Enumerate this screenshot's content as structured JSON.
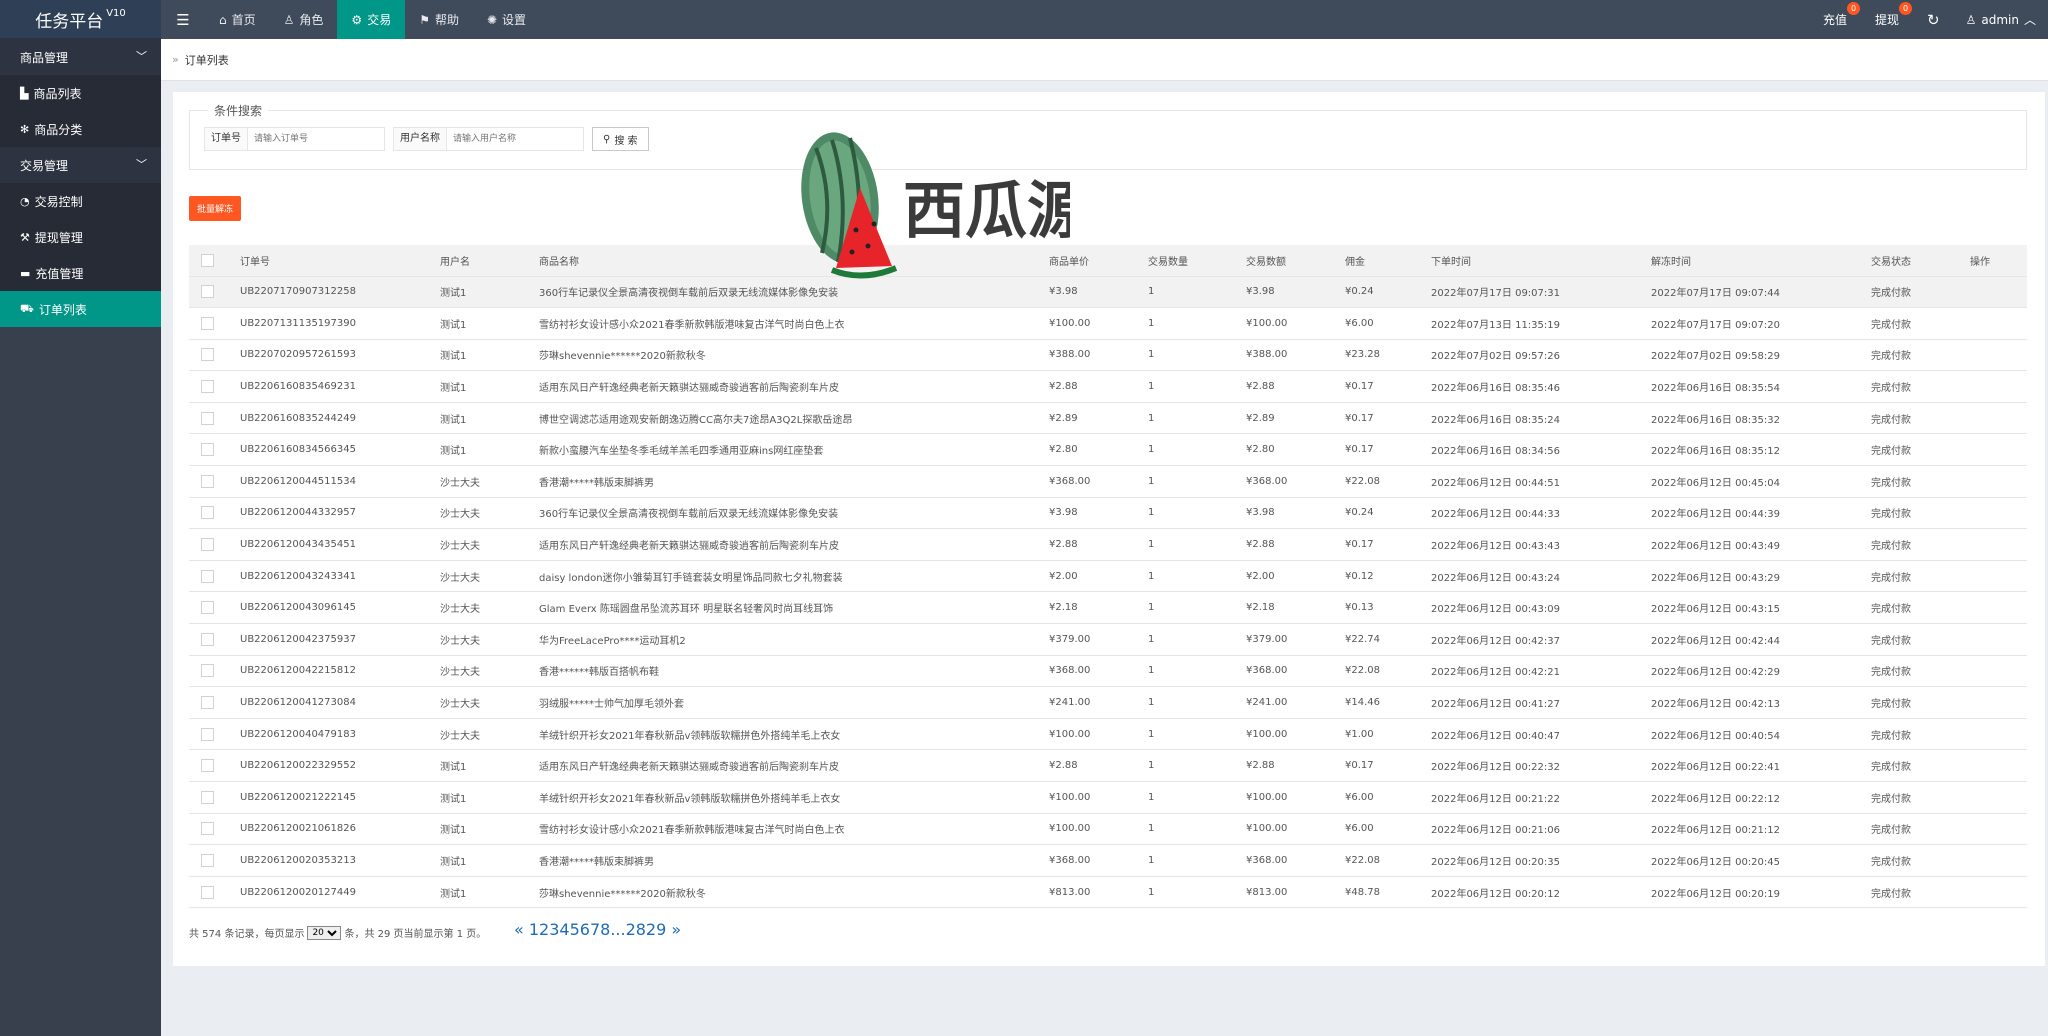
{
  "app": {
    "title": "任务平台",
    "version": "V10"
  },
  "topnav": [
    {
      "label": "首页",
      "icon": "home-icon",
      "glyph": "⌂",
      "active": false
    },
    {
      "label": "角色",
      "icon": "user-icon",
      "glyph": "♙",
      "active": false
    },
    {
      "label": "交易",
      "icon": "exchange-icon",
      "glyph": "⚙",
      "active": true
    },
    {
      "label": "帮助",
      "icon": "flag-icon",
      "glyph": "⚑",
      "active": false
    },
    {
      "label": "设置",
      "icon": "gear-icon",
      "glyph": "✺",
      "active": false
    }
  ],
  "topright": {
    "recharge_label": "充值",
    "recharge_badge": "0",
    "withdraw_label": "提现",
    "withdraw_badge": "0",
    "user": "admin"
  },
  "sidebar": {
    "groups": [
      {
        "label": "商品管理",
        "items": [
          {
            "label": "商品列表",
            "icon": "cart-icon",
            "glyph": "▙",
            "active": false
          },
          {
            "label": "商品分类",
            "icon": "snowflake-icon",
            "glyph": "✻",
            "active": false
          }
        ]
      },
      {
        "label": "交易管理",
        "items": [
          {
            "label": "交易控制",
            "icon": "dashboard-icon",
            "glyph": "◔",
            "active": false
          },
          {
            "label": "提现管理",
            "icon": "gavel-icon",
            "glyph": "⚒",
            "active": false
          },
          {
            "label": "充值管理",
            "icon": "comment-icon",
            "glyph": "▬",
            "active": false
          },
          {
            "label": "订单列表",
            "icon": "cart-icon",
            "glyph": "⛟",
            "active": true
          }
        ]
      }
    ]
  },
  "breadcrumb": {
    "label": "订单列表"
  },
  "search": {
    "legend": "条件搜索",
    "order_label": "订单号",
    "order_placeholder": "请输入订单号",
    "username_label": "用户名称",
    "username_placeholder": "请输入用户名称",
    "button": "搜 索"
  },
  "batch_button": "批量解冻",
  "table": {
    "headers": [
      "订单号",
      "用户名",
      "商品名称",
      "商品单价",
      "交易数量",
      "交易数额",
      "佣金",
      "下单时间",
      "解冻时间",
      "交易状态",
      "操作"
    ],
    "rows": [
      [
        "UB2207170907312258",
        "测试1",
        "360行车记录仪全景高清夜视倒车载前后双录无线流媒体影像免安装",
        "¥3.98",
        "1",
        "¥3.98",
        "¥0.24",
        "2022年07月17日 09:07:31",
        "2022年07月17日 09:07:44",
        "完成付款",
        ""
      ],
      [
        "UB2207131135197390",
        "测试1",
        "雪纺衬衫女设计感小众2021春季新款韩版港味复古洋气时尚白色上衣",
        "¥100.00",
        "1",
        "¥100.00",
        "¥6.00",
        "2022年07月13日 11:35:19",
        "2022年07月17日 09:07:20",
        "完成付款",
        ""
      ],
      [
        "UB2207020957261593",
        "测试1",
        "莎琳shevennie******2020新款秋冬",
        "¥388.00",
        "1",
        "¥388.00",
        "¥23.28",
        "2022年07月02日 09:57:26",
        "2022年07月02日 09:58:29",
        "完成付款",
        ""
      ],
      [
        "UB2206160835469231",
        "测试1",
        "适用东风日产轩逸经典老新天籁骐达骊威奇骏逍客前后陶瓷刹车片皮",
        "¥2.88",
        "1",
        "¥2.88",
        "¥0.17",
        "2022年06月16日 08:35:46",
        "2022年06月16日 08:35:54",
        "完成付款",
        ""
      ],
      [
        "UB2206160835244249",
        "测试1",
        "博世空调滤芯适用途观安新朗逸迈腾CC高尔夫7途昂A3Q2L探歌岳途昂",
        "¥2.89",
        "1",
        "¥2.89",
        "¥0.17",
        "2022年06月16日 08:35:24",
        "2022年06月16日 08:35:32",
        "完成付款",
        ""
      ],
      [
        "UB2206160834566345",
        "测试1",
        "新款小蛮腰汽车坐垫冬季毛绒羊羔毛四季通用亚麻ins网红座垫套",
        "¥2.80",
        "1",
        "¥2.80",
        "¥0.17",
        "2022年06月16日 08:34:56",
        "2022年06月16日 08:35:12",
        "完成付款",
        ""
      ],
      [
        "UB2206120044511534",
        "沙士大夫",
        "香港潮*****韩版束脚裤男",
        "¥368.00",
        "1",
        "¥368.00",
        "¥22.08",
        "2022年06月12日 00:44:51",
        "2022年06月12日 00:45:04",
        "完成付款",
        ""
      ],
      [
        "UB2206120044332957",
        "沙士大夫",
        "360行车记录仪全景高清夜视倒车载前后双录无线流媒体影像免安装",
        "¥3.98",
        "1",
        "¥3.98",
        "¥0.24",
        "2022年06月12日 00:44:33",
        "2022年06月12日 00:44:39",
        "完成付款",
        ""
      ],
      [
        "UB2206120043435451",
        "沙士大夫",
        "适用东风日产轩逸经典老新天籁骐达骊威奇骏逍客前后陶瓷刹车片皮",
        "¥2.88",
        "1",
        "¥2.88",
        "¥0.17",
        "2022年06月12日 00:43:43",
        "2022年06月12日 00:43:49",
        "完成付款",
        ""
      ],
      [
        "UB2206120043243341",
        "沙士大夫",
        "daisy london迷你小雏菊耳钉手链套装女明星饰品同款七夕礼物套装",
        "¥2.00",
        "1",
        "¥2.00",
        "¥0.12",
        "2022年06月12日 00:43:24",
        "2022年06月12日 00:43:29",
        "完成付款",
        ""
      ],
      [
        "UB2206120043096145",
        "沙士大夫",
        "Glam Everx 陈瑶圆盘吊坠流苏耳环 明星联名轻奢风时尚耳线耳饰",
        "¥2.18",
        "1",
        "¥2.18",
        "¥0.13",
        "2022年06月12日 00:43:09",
        "2022年06月12日 00:43:15",
        "完成付款",
        ""
      ],
      [
        "UB2206120042375937",
        "沙士大夫",
        "华为FreeLacePro****运动耳机2",
        "¥379.00",
        "1",
        "¥379.00",
        "¥22.74",
        "2022年06月12日 00:42:37",
        "2022年06月12日 00:42:44",
        "完成付款",
        ""
      ],
      [
        "UB2206120042215812",
        "沙士大夫",
        "香港******韩版百搭帆布鞋",
        "¥368.00",
        "1",
        "¥368.00",
        "¥22.08",
        "2022年06月12日 00:42:21",
        "2022年06月12日 00:42:29",
        "完成付款",
        ""
      ],
      [
        "UB2206120041273084",
        "沙士大夫",
        "羽绒服*****士帅气加厚毛领外套",
        "¥241.00",
        "1",
        "¥241.00",
        "¥14.46",
        "2022年06月12日 00:41:27",
        "2022年06月12日 00:42:13",
        "完成付款",
        ""
      ],
      [
        "UB2206120040479183",
        "沙士大夫",
        "羊绒针织开衫女2021年春秋新品v领韩版软糯拼色外搭纯羊毛上衣女",
        "¥100.00",
        "1",
        "¥100.00",
        "¥1.00",
        "2022年06月12日 00:40:47",
        "2022年06月12日 00:40:54",
        "完成付款",
        ""
      ],
      [
        "UB2206120022329552",
        "测试1",
        "适用东风日产轩逸经典老新天籁骐达骊威奇骏逍客前后陶瓷刹车片皮",
        "¥2.88",
        "1",
        "¥2.88",
        "¥0.17",
        "2022年06月12日 00:22:32",
        "2022年06月12日 00:22:41",
        "完成付款",
        ""
      ],
      [
        "UB2206120021222145",
        "测试1",
        "羊绒针织开衫女2021年春秋新品v领韩版软糯拼色外搭纯羊毛上衣女",
        "¥100.00",
        "1",
        "¥100.00",
        "¥6.00",
        "2022年06月12日 00:21:22",
        "2022年06月12日 00:22:12",
        "完成付款",
        ""
      ],
      [
        "UB2206120021061826",
        "测试1",
        "雪纺衬衫女设计感小众2021春季新款韩版港味复古洋气时尚白色上衣",
        "¥100.00",
        "1",
        "¥100.00",
        "¥6.00",
        "2022年06月12日 00:21:06",
        "2022年06月12日 00:21:12",
        "完成付款",
        ""
      ],
      [
        "UB2206120020353213",
        "测试1",
        "香港潮*****韩版束脚裤男",
        "¥368.00",
        "1",
        "¥368.00",
        "¥22.08",
        "2022年06月12日 00:20:35",
        "2022年06月12日 00:20:45",
        "完成付款",
        ""
      ],
      [
        "UB2206120020127449",
        "测试1",
        "莎琳shevennie******2020新款秋冬",
        "¥813.00",
        "1",
        "¥813.00",
        "¥48.78",
        "2022年06月12日 00:20:12",
        "2022年06月12日 00:20:19",
        "完成付款",
        ""
      ]
    ]
  },
  "pagination": {
    "info_prefix": "共 574 条记录，每页显示",
    "page_size": "20",
    "info_suffix": "条，共 29 页当前显示第 1 页。",
    "links": "« 12345678...2829 »"
  },
  "watermark": {
    "text": "西瓜源码"
  },
  "colors": {
    "accent": "#009688",
    "danger": "#ff5722",
    "topbar": "#3f4a5a",
    "sidebar": "#383f4d",
    "link": "#1e6bb8"
  }
}
